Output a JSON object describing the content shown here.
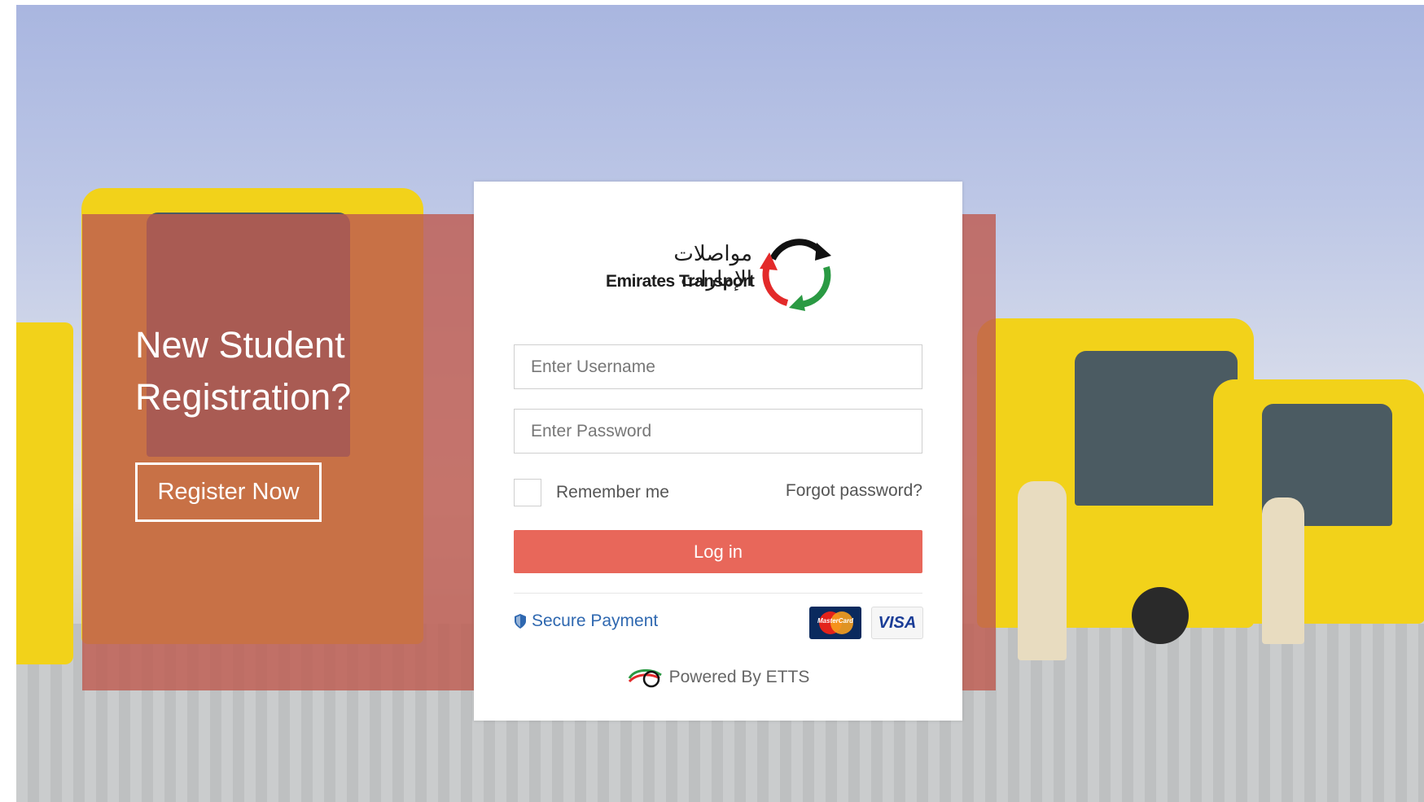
{
  "promo": {
    "title_line1": "New Student",
    "title_line2": "Registration?",
    "register_label": "Register Now"
  },
  "logo": {
    "arabic": "مواصلات الإمارات",
    "english": "Emirates Transport"
  },
  "login_form": {
    "username_placeholder": "Enter Username",
    "password_placeholder": "Enter Password",
    "remember_label": "Remember me",
    "forgot_label": "Forgot password?",
    "login_label": "Log in"
  },
  "payment": {
    "secure_label": "Secure Payment",
    "mastercard_text": "MasterCard",
    "visa_text": "VISA"
  },
  "footer": {
    "powered_label": "Powered By ETTS"
  },
  "colors": {
    "login_button": "#e8675a",
    "overlay": "#be5c50",
    "secure_link": "#2f68b0"
  }
}
